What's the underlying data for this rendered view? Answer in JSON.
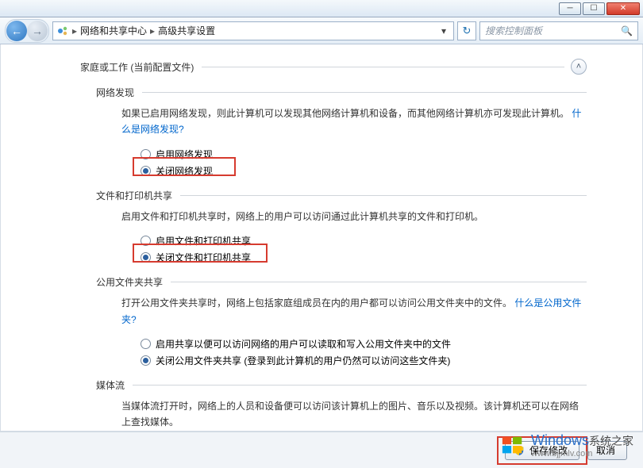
{
  "window": {
    "minimize_title": "最小化",
    "maximize_title": "最大化",
    "close_title": "关闭"
  },
  "nav": {
    "back_title": "后退",
    "forward_title": "前进",
    "breadcrumb1": "网络和共享中心",
    "breadcrumb2": "高级共享设置",
    "refresh_title": "刷新",
    "search_placeholder": "搜索控制面板"
  },
  "profile": {
    "label": "家庭或工作  (当前配置文件)",
    "expand_title": "折叠"
  },
  "sections": {
    "network_discovery": {
      "title": "网络发现",
      "body_prefix": "如果已启用网络发现，则此计算机可以发现其他网络计算机和设备，而其他网络计算机亦可发现此计算机。",
      "link": "什么是网络发现?",
      "opt_on": "启用网络发现",
      "opt_off": "关闭网络发现"
    },
    "file_printer": {
      "title": "文件和打印机共享",
      "body": "启用文件和打印机共享时，网络上的用户可以访问通过此计算机共享的文件和打印机。",
      "opt_on": "启用文件和打印机共享",
      "opt_off": "关闭文件和打印机共享"
    },
    "public_folder": {
      "title": "公用文件夹共享",
      "body_prefix": "打开公用文件夹共享时，网络上包括家庭组成员在内的用户都可以访问公用文件夹中的文件。",
      "link": "什么是公用文件夹?",
      "opt_on": "启用共享以便可以访问网络的用户可以读取和写入公用文件夹中的文件",
      "opt_off": "关闭公用文件夹共享 (登录到此计算机的用户仍然可以访问这些文件夹)"
    },
    "media_stream": {
      "title": "媒体流",
      "body": "当媒体流打开时，网络上的人员和设备便可以访问该计算机上的图片、音乐以及视频。该计算机还可以在网络上查找媒体。"
    }
  },
  "footer": {
    "save": "保存修改",
    "cancel": "取消"
  },
  "watermark": {
    "brand": "Windows",
    "suffix": "系统之家",
    "url": "www.bjjmlv.com"
  }
}
